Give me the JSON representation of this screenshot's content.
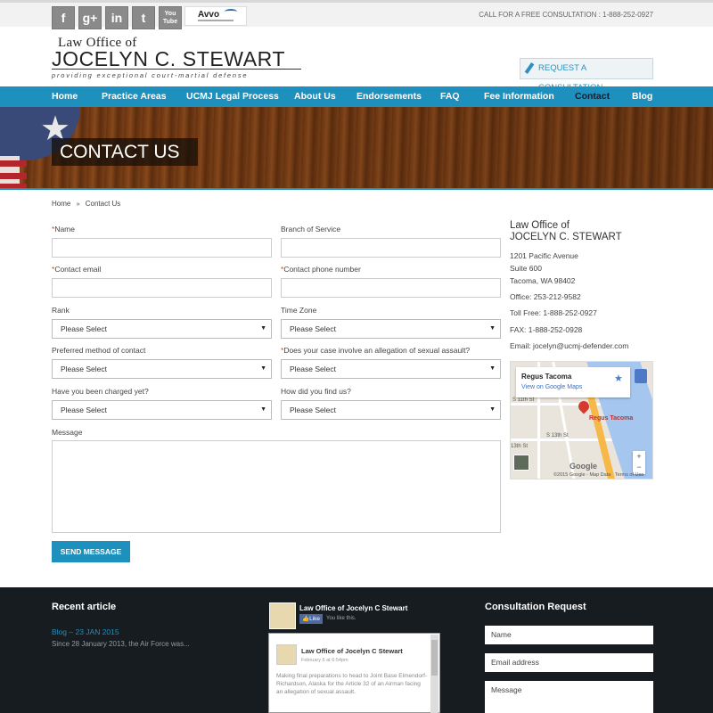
{
  "topbar": {
    "social": [
      "f",
      "g+",
      "in",
      "t",
      "You Tube"
    ],
    "avvo": "Avvo",
    "call": "CALL FOR A FREE CONSULTATION : 1-888-252-0927"
  },
  "header": {
    "logo_line1": "Law Office of",
    "logo_line2": "JOCELYN C. STEWART",
    "logo_tagline": "providing exceptional court-martial defense",
    "request_button": "REQUEST A CONSULTATION"
  },
  "nav": {
    "items": [
      "Home",
      "Practice Areas",
      "UCMJ Legal Process",
      "About Us",
      "Endorsements",
      "FAQ",
      "Fee Information",
      "Contact",
      "Blog"
    ],
    "active": "Contact"
  },
  "banner": {
    "title": "CONTACT US"
  },
  "breadcrumb": {
    "home": "Home",
    "sep": "»",
    "current": "Contact Us"
  },
  "form": {
    "name_label": "Name",
    "branch_label": "Branch of Service",
    "email_label": "Contact email",
    "phone_label": "Contact phone number",
    "rank_label": "Rank",
    "rank_value": "Please Select",
    "timezone_label": "Time Zone",
    "timezone_value": "Please Select",
    "preferred_label": "Preferred method of contact",
    "preferred_value": "Please Select",
    "sexual_label": "Does your case involve an allegation of sexual assault?",
    "sexual_value": "Please Select",
    "charged_label": "Have you been charged yet?",
    "charged_value": "Please Select",
    "found_label": "How did you find us?",
    "found_value": "Please Select",
    "message_label": "Message",
    "required_mark": "*",
    "send_button": "SEND MESSAGE"
  },
  "sidebar": {
    "name_line1": "Law Office of",
    "name_line2": "JOCELYN C. STEWART",
    "address1": "1201 Pacific Avenue",
    "address2": "Suite 600",
    "address3": "Tacoma, WA 98402",
    "office": "Office: 253-212-9582",
    "tollfree": "Toll Free: 1-888-252-0927",
    "fax": "FAX: 1-888-252-0928",
    "email": "Email: jocelyn@ucmj-defender.com"
  },
  "map": {
    "place": "Regus Tacoma",
    "view_link": "View on Google Maps",
    "pin_label": "Regus Tacoma",
    "street1": "S 11th St",
    "street2": "S 13th St",
    "street3": "13th St",
    "google": "Google",
    "attribution": "©2015 Google - Map Data",
    "terms": "Terms of Use",
    "zoom_in": "+",
    "zoom_out": "−",
    "star": "★"
  },
  "footer": {
    "recent_title": "Recent article",
    "recent_link": "Blog – 23 JAN 2015",
    "recent_text": "Since 28 January 2013, the Air Force was...",
    "fb_page": "Law Office of Jocelyn C Stewart",
    "fb_like": "Like",
    "fb_like_text": "You like this.",
    "fb_post_author": "Law Office of Jocelyn C Stewart",
    "fb_post_date": "February 5 at 6:54pm",
    "fb_post_text": "Making final preparations to head to Joint Base Elmendorf-Richardson, Alaska for the Article 32 of an Airman facing an allegation of sexual assault.",
    "consult_title": "Consultation Request",
    "consult_name": "Name",
    "consult_email": "Email address",
    "consult_message": "Message"
  },
  "colors": {
    "accent": "#1e90bd",
    "footer_bg": "#171c20",
    "required": "#e0402a"
  }
}
